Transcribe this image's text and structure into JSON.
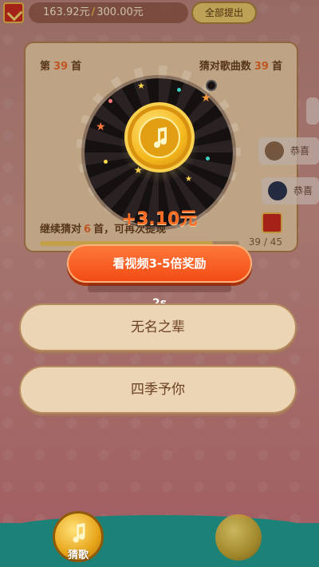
{
  "top_bar": {
    "balance": "163.92元",
    "target": "300.00元",
    "withdraw_all_label": "全部提出"
  },
  "card": {
    "question_prefix": "第",
    "question_number": "39",
    "question_suffix": "首",
    "guessed_label": "猜对歌曲数",
    "guessed_count": "39",
    "guessed_suffix": "首",
    "continue_prefix": "继续猜对",
    "continue_count": "6",
    "continue_suffix": "首，可再次提现",
    "progress": {
      "current": 39,
      "total": 45,
      "text": "39 / 45",
      "fraction": 0.867
    }
  },
  "side_chips": [
    {
      "label": "恭喜"
    },
    {
      "label": "恭喜"
    }
  ],
  "reward": {
    "amount": "+3.10元"
  },
  "cta": {
    "watch_video_label": "看视频3-5倍奖励",
    "countdown": "2s"
  },
  "answers": [
    {
      "label": "无名之辈"
    },
    {
      "label": "四季予你"
    }
  ],
  "bottom_nav": {
    "guess_label": "猜歌"
  },
  "colors": {
    "accent_orange": "#f24a14",
    "reward_text": "#ff6a22",
    "nav_teal": "#1c8278"
  },
  "icons": [
    "red-packet-icon",
    "music-note-icon",
    "star-icon",
    "avatar-icon"
  ]
}
